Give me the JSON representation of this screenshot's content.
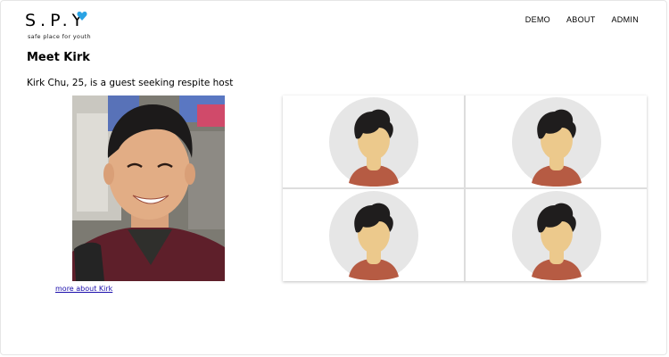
{
  "brand": {
    "logo_text": "S.P.Y",
    "tagline": "safe place for youth",
    "accent": "#2aa3e4"
  },
  "nav": {
    "items": [
      {
        "label": "DEMO"
      },
      {
        "label": "ABOUT"
      },
      {
        "label": "ADMIN"
      }
    ]
  },
  "main": {
    "title": "Meet Kirk",
    "subtitle": "Kirk Chu, 25, is a guest seeking respite host",
    "more_link": "more about Kirk"
  },
  "host_grid": {
    "count": 4,
    "icon": "avatar-placeholder-icon",
    "colors": {
      "circle": "#e6e6e6",
      "hair": "#1f1d1d",
      "skin": "#ecc98c",
      "shirt": "#b65b43"
    }
  }
}
